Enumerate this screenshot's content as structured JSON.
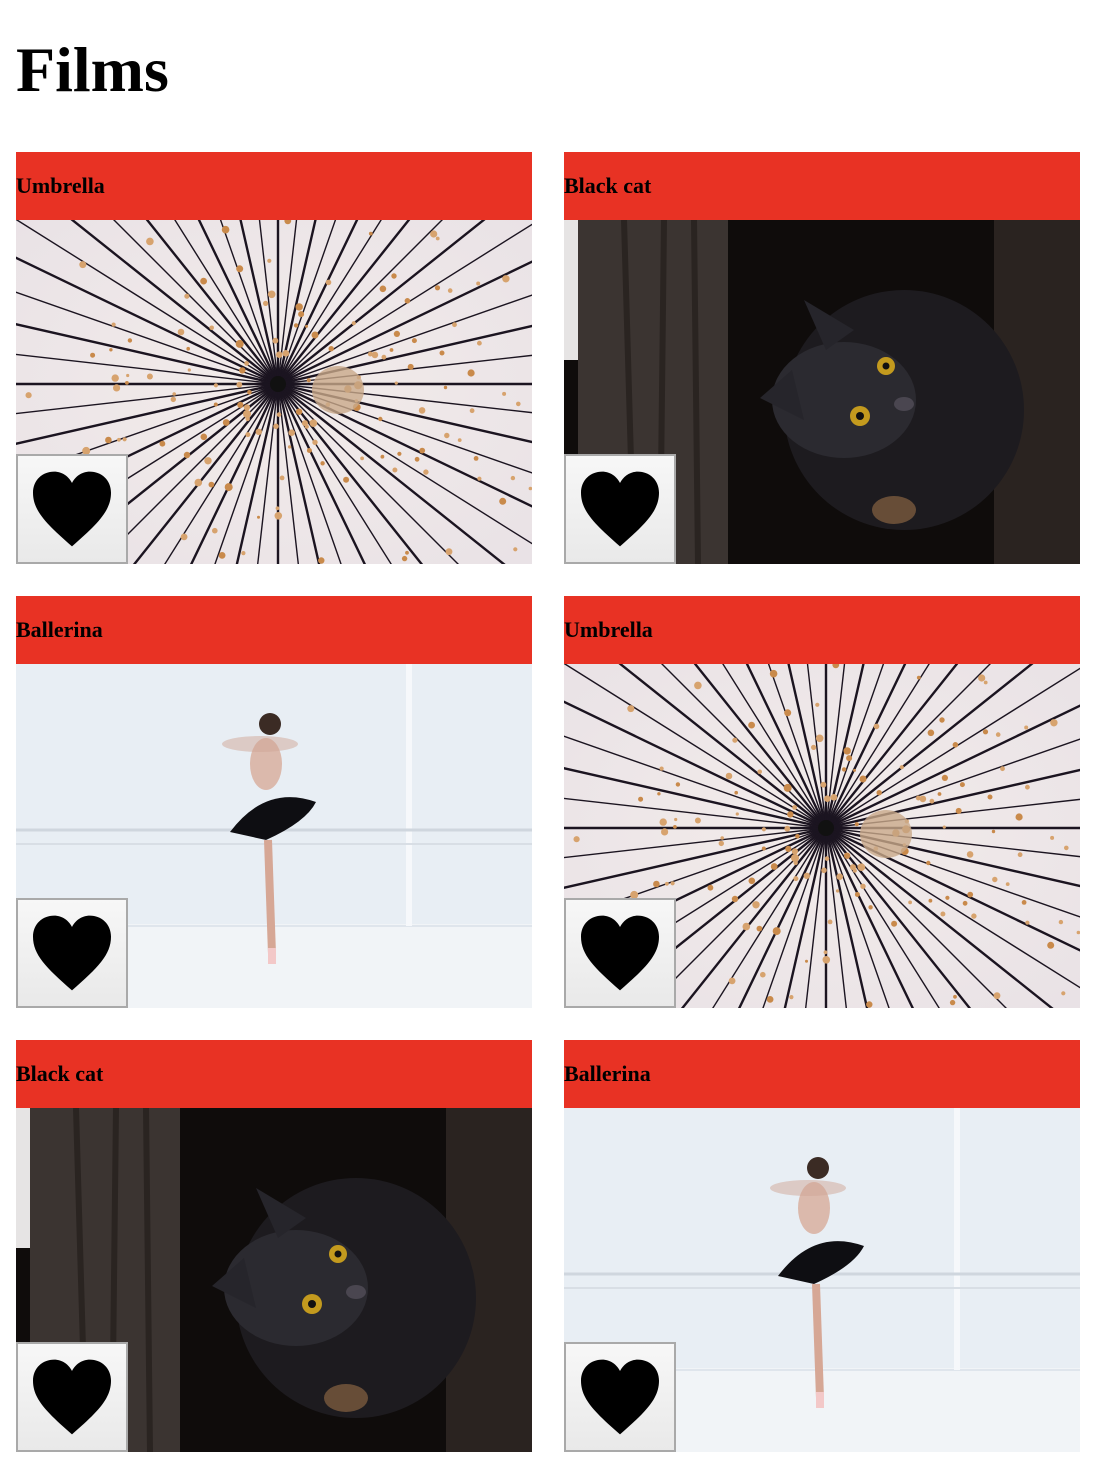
{
  "page": {
    "title": "Films"
  },
  "theme": {
    "header_color": "#e83224",
    "heart_color": "#000000"
  },
  "films": [
    {
      "title": "Umbrella",
      "image": "umbrella",
      "like_icon": "heart-icon"
    },
    {
      "title": "Black cat",
      "image": "black-cat",
      "like_icon": "heart-icon"
    },
    {
      "title": "Ballerina",
      "image": "ballerina",
      "like_icon": "heart-icon"
    },
    {
      "title": "Umbrella",
      "image": "umbrella",
      "like_icon": "heart-icon"
    },
    {
      "title": "Black cat",
      "image": "black-cat",
      "like_icon": "heart-icon"
    },
    {
      "title": "Ballerina",
      "image": "ballerina",
      "like_icon": "heart-icon"
    }
  ]
}
